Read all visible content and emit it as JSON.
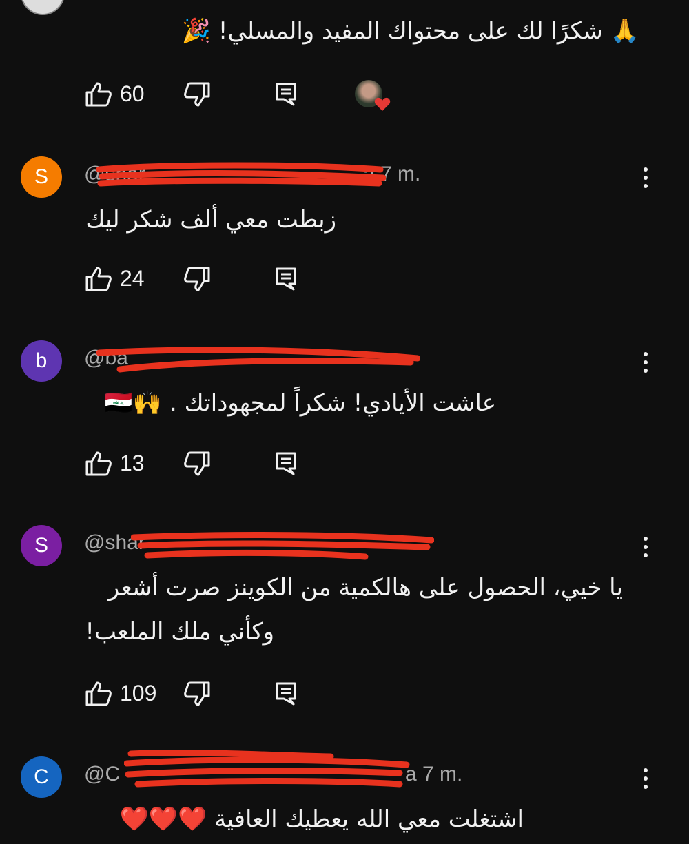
{
  "comments": [
    {
      "text": "🙏 شكرًا لك على محتواك المفيد والمسلي! 🎉",
      "likes": "60"
    },
    {
      "avatar_letter": "S",
      "avatar_color": "#f57c00",
      "handle": "@shar",
      "time": "a 7 m.",
      "text": "زبطت معي ألف شكر ليك",
      "likes": "24"
    },
    {
      "avatar_letter": "b",
      "avatar_color": "#5e35b1",
      "handle": "@ba",
      "time": "",
      "text": "عاشت الأيادي! شكراً لمجهوداتك . 🙌🇮🇶",
      "likes": "13"
    },
    {
      "avatar_letter": "S",
      "avatar_color": "#7b1fa2",
      "handle": "@shar",
      "time": "",
      "text_line1": "يا خيي، الحصول على هالكمية من الكوينز صرت أشعر",
      "text_line2": "وكأني ملك الملعب!",
      "likes": "109"
    },
    {
      "avatar_letter": "C",
      "avatar_color": "#1565c0",
      "handle": "@C",
      "time": "a 7 m.",
      "text": "اشتغلت معي الله يعطيك العافية ❤️❤️❤️"
    }
  ],
  "icons": [
    "like-icon",
    "dislike-icon",
    "reply-icon",
    "more-options-icon"
  ],
  "colors": {
    "background": "#0f0f0f",
    "text": "#f1f1f1",
    "secondary": "#aaaaaa",
    "redaction": "#e8321e"
  }
}
